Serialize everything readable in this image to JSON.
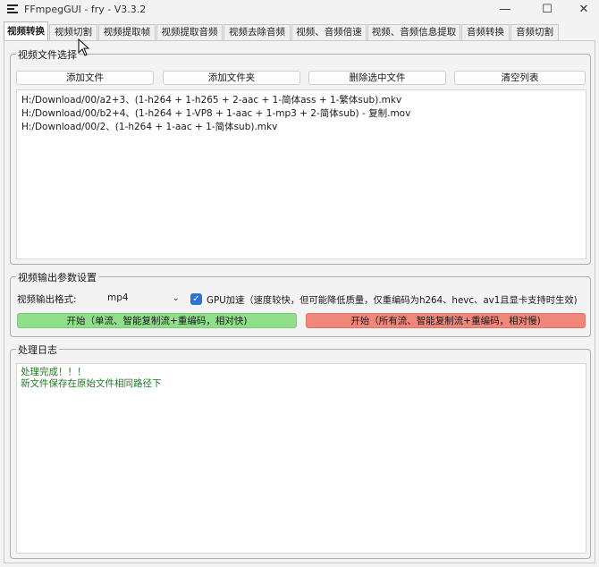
{
  "window": {
    "title": "FFmpegGUI - fry - V3.3.2",
    "minimize_glyph": "—",
    "maximize_glyph": "☐",
    "close_glyph": "✕"
  },
  "tabs": [
    {
      "label": "视频转换",
      "active": true
    },
    {
      "label": "视频切割"
    },
    {
      "label": "视频提取帧"
    },
    {
      "label": "视频提取音频"
    },
    {
      "label": "视频去除音频"
    },
    {
      "label": "视频、音频倍速"
    },
    {
      "label": "视频、音频信息提取"
    },
    {
      "label": "音频转换"
    },
    {
      "label": "音频切割"
    }
  ],
  "file_select": {
    "title": "视频文件选择",
    "add_file": "添加文件",
    "add_folder": "添加文件夹",
    "delete_selected": "删除选中文件",
    "clear_list": "清空列表",
    "files": [
      "H:/Download/00/a2+3、(1-h264 + 1-h265 + 2-aac + 1-简体ass + 1-繁体sub).mkv",
      "H:/Download/00/b2+4、(1-h264 + 1-VP8 + 1-aac  + 1-mp3 + 2-简体sub) - 复制.mov",
      "H:/Download/00/2、(1-h264 + 1-aac + 1-简体sub).mkv"
    ]
  },
  "output_settings": {
    "title": "视频输出参数设置",
    "format_label": "视频输出格式:",
    "format_value": "mp4",
    "gpu_label": "GPU加速（速度较快，但可能降低质量，仅重编码为h264、hevc、av1且显卡支持时生效)",
    "gpu_checked": true,
    "start_fast": "开始（单流、智能复制流+重编码，相对快)",
    "start_slow": "开始（所有流、智能复制流+重编码，相对慢)",
    "colors": {
      "start_fast_bg": "#8fdf8a",
      "start_slow_bg": "#f0877a",
      "checkbox": "#2f72d3"
    }
  },
  "log": {
    "title": "处理日志",
    "lines": [
      "处理完成！！！",
      "新文件保存在原始文件相同路径下"
    ],
    "color": "#1f7a1f"
  }
}
